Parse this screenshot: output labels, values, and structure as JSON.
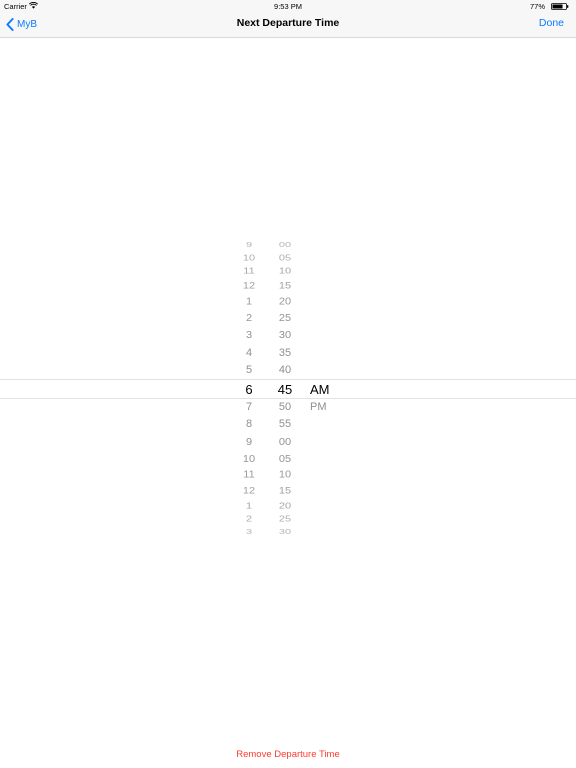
{
  "status_bar": {
    "carrier": "Carrier",
    "time": "9:53 PM",
    "battery": "77%",
    "battery_level": 0.77
  },
  "nav": {
    "back_label": "MyB",
    "title": "Next Departure Time",
    "done_label": "Done"
  },
  "picker": {
    "selected": {
      "hour": "6",
      "minute": "45",
      "period": "AM"
    },
    "period_options": [
      "AM",
      "PM"
    ],
    "hour_column": [
      "9",
      "10",
      "11",
      "12",
      "1",
      "2",
      "3",
      "4",
      "5",
      "6",
      "7",
      "8",
      "9",
      "10",
      "11",
      "12",
      "1",
      "2",
      "3"
    ],
    "minute_column": [
      "00",
      "05",
      "10",
      "15",
      "20",
      "25",
      "30",
      "35",
      "40",
      "45",
      "50",
      "55",
      "00",
      "05",
      "10",
      "15",
      "20",
      "25",
      "30"
    ]
  },
  "footer": {
    "remove_label": "Remove Departure Time"
  },
  "colors": {
    "accent": "#0a7aff",
    "destructive": "#ff3b30",
    "selected_text": "#000000",
    "dim_text": "#8e8e93"
  }
}
